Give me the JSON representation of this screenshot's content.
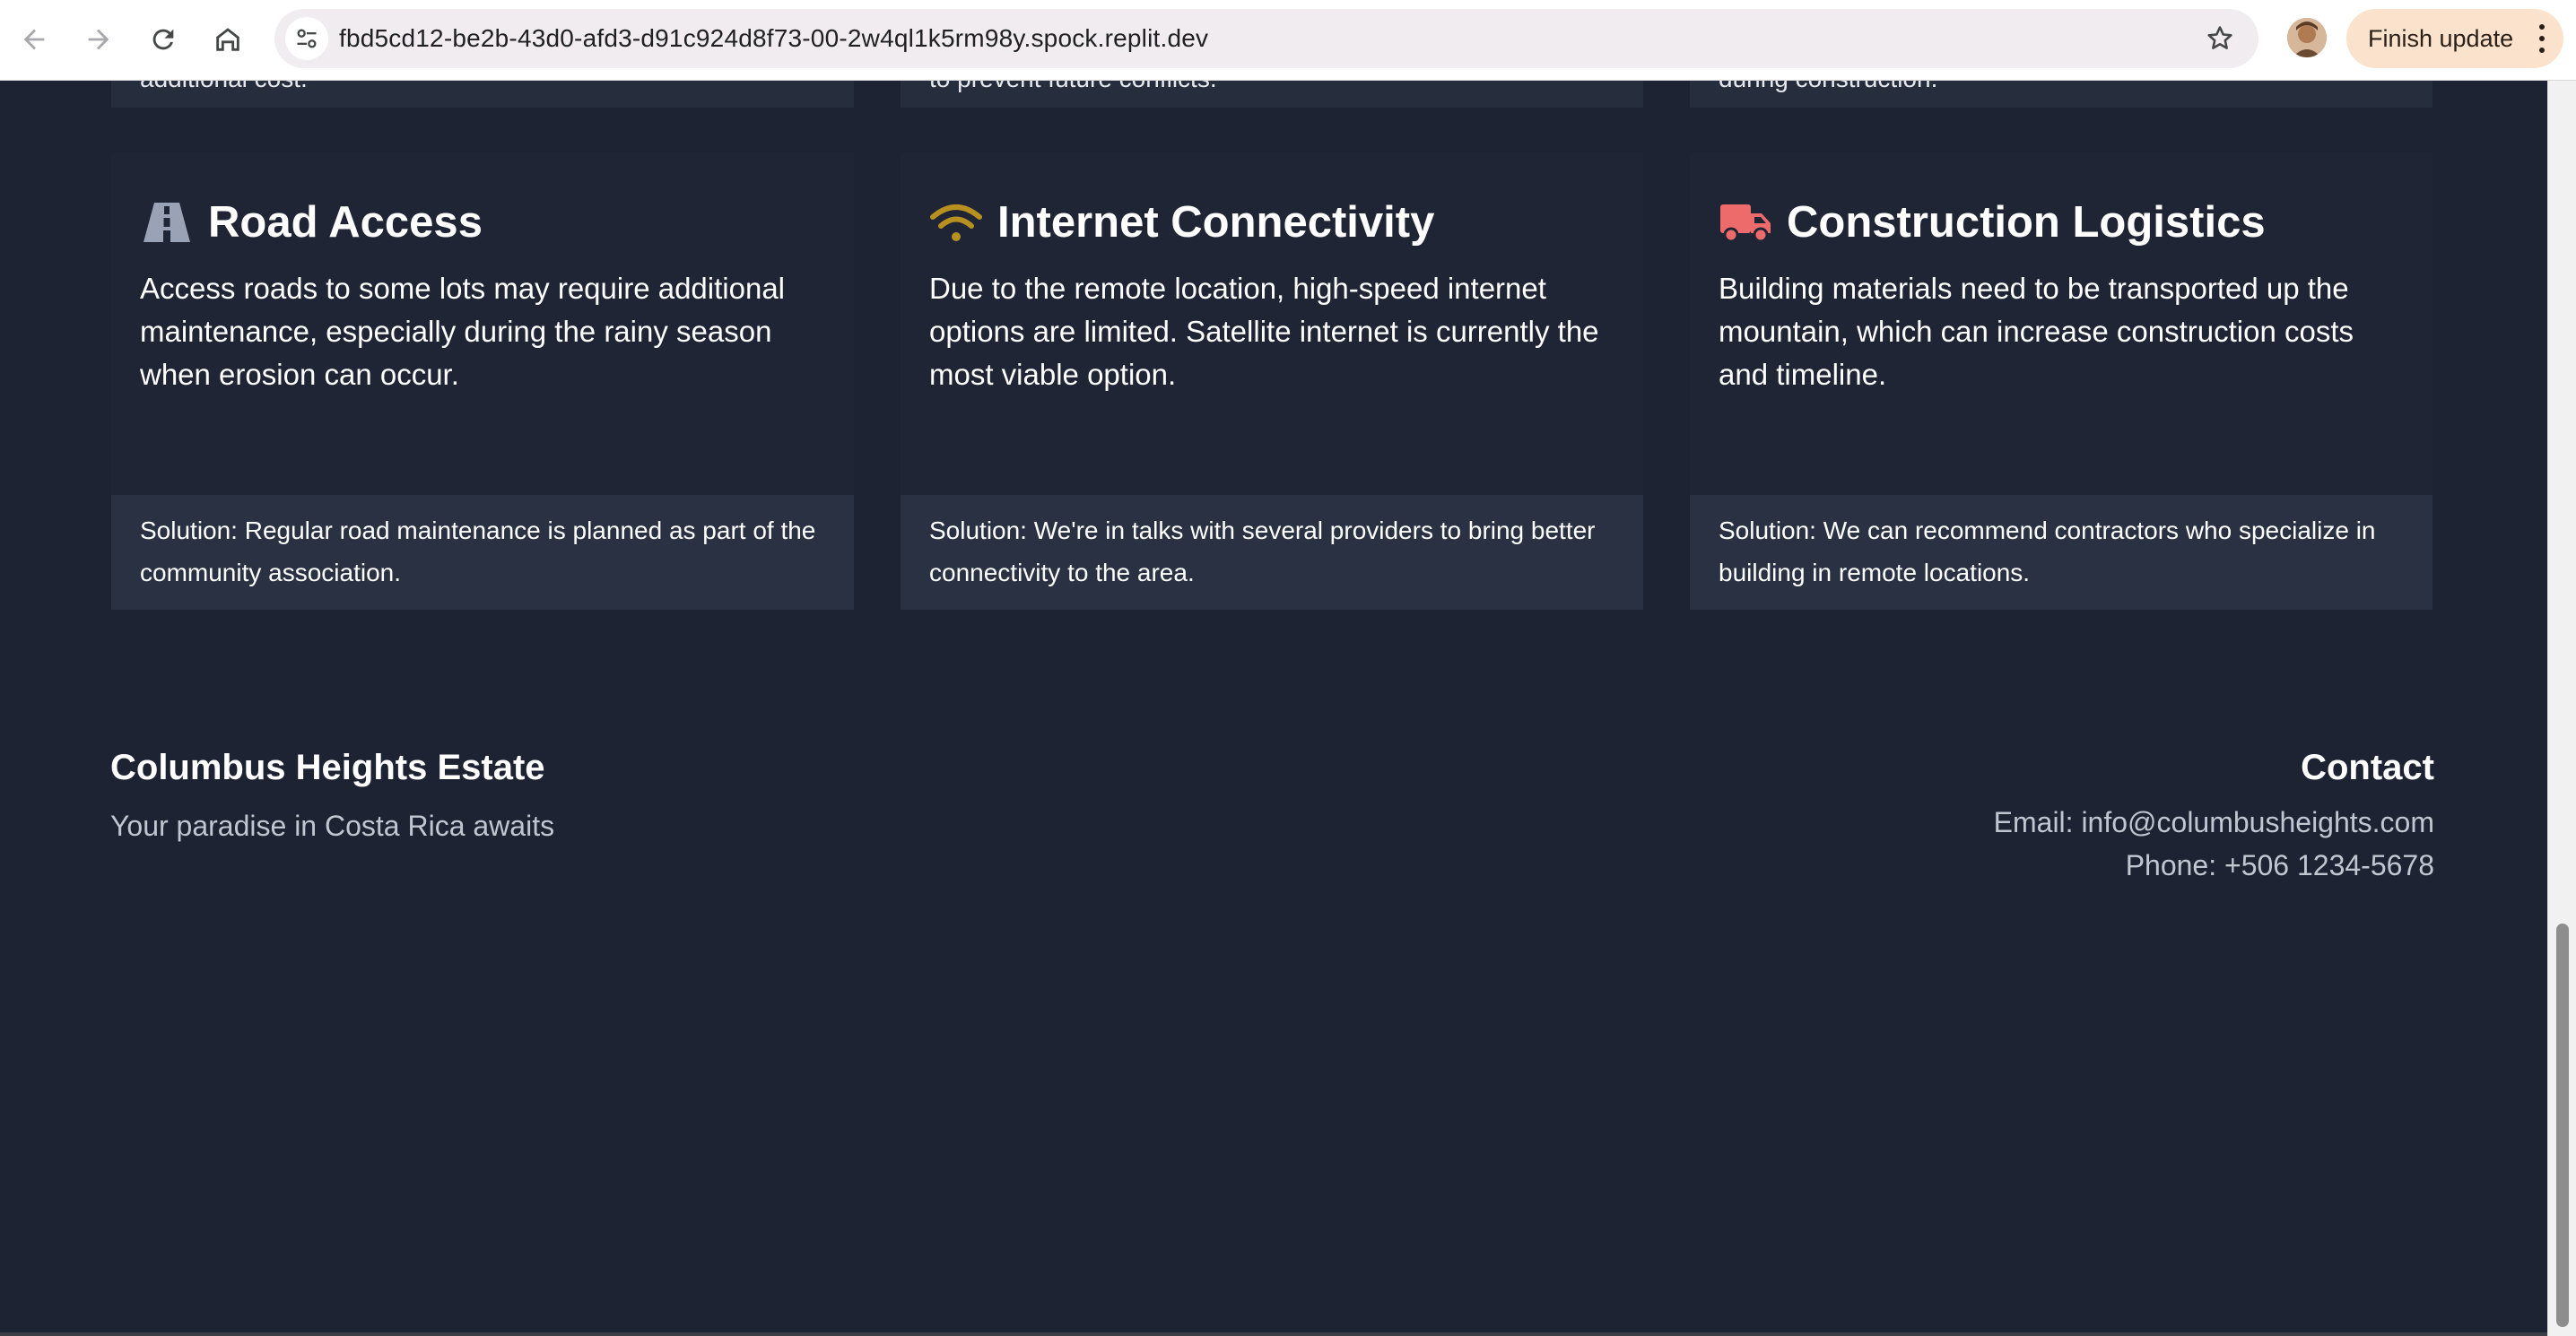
{
  "browser": {
    "url": "fbd5cd12-be2b-43d0-afd3-d91c924d8f73-00-2w4ql1k5rm98y.spock.replit.dev",
    "finish_update_label": "Finish update",
    "icons": [
      "back-icon",
      "forward-icon",
      "reload-icon",
      "home-icon",
      "site-info-icon",
      "bookmark-star-icon",
      "profile-avatar",
      "more-vert-icon"
    ]
  },
  "challenges_top_row": [
    {
      "partial_text": "additional cost."
    },
    {
      "partial_text": "to prevent future conflicts."
    },
    {
      "partial_text": "during construction."
    }
  ],
  "challenges": [
    {
      "icon": "road-icon",
      "icon_color": "#9aa3b5",
      "title": "Road Access",
      "description": "Access roads to some lots may require additional maintenance, especially during the rainy season when erosion can occur.",
      "solution": "Solution: Regular road maintenance is planned as part of the community association."
    },
    {
      "icon": "wifi-icon",
      "icon_color": "#b8901f",
      "title": "Internet Connectivity",
      "description": "Due to the remote location, high-speed internet options are limited. Satellite internet is currently the most viable option.",
      "solution": "Solution: We're in talks with several providers to bring better connectivity to the area."
    },
    {
      "icon": "truck-icon",
      "icon_color": "#ee6b6b",
      "title": "Construction Logistics",
      "description": "Building materials need to be transported up the mountain, which can increase construction costs and timeline.",
      "solution": "Solution: We can recommend contractors who specialize in building in remote locations."
    }
  ],
  "footer": {
    "brand": "Columbus Heights Estate",
    "tagline": "Your paradise in Costa Rica awaits",
    "contact_title": "Contact",
    "email": "Email: info@columbusheights.com",
    "phone": "Phone: +506 1234-5678"
  },
  "colors": {
    "page_background": "#1d2333",
    "card_background": "#1f2535",
    "solution_background": "#2a3142",
    "finish_update_background": "#fbe2cd"
  }
}
